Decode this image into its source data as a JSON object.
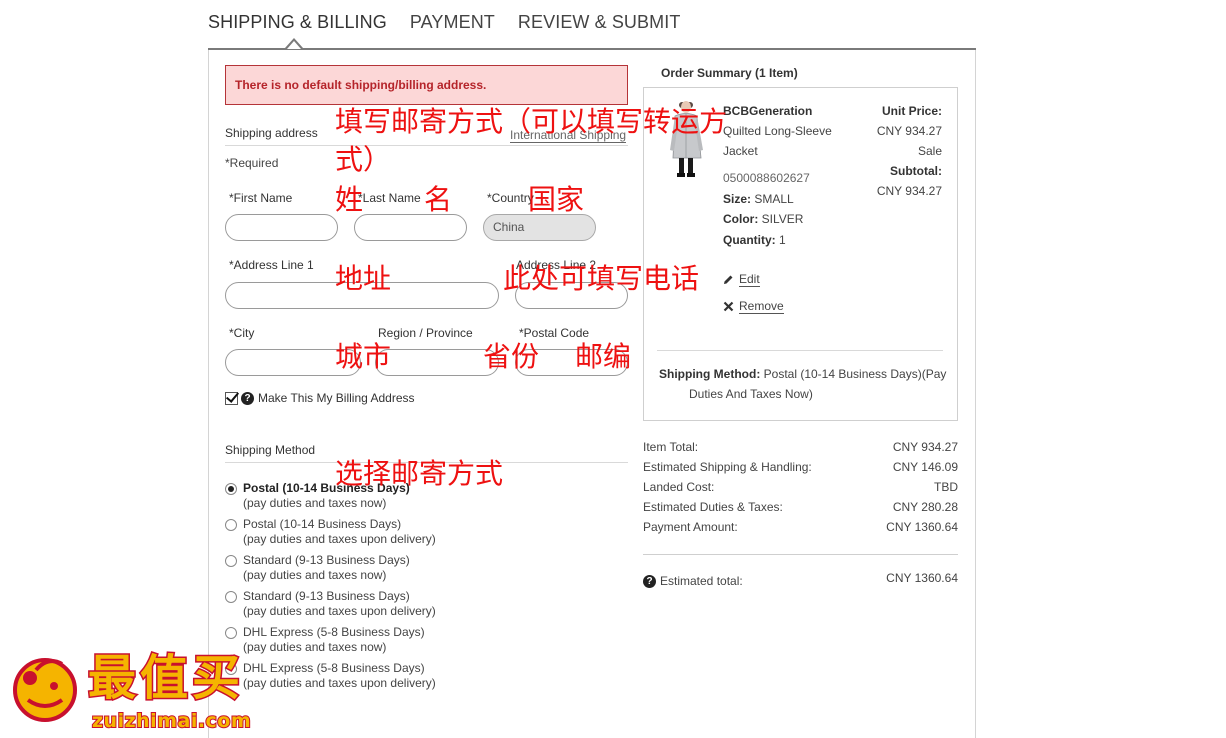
{
  "tabs": [
    "SHIPPING & BILLING",
    "PAYMENT",
    "REVIEW & SUBMIT"
  ],
  "alert": "There is no default shipping/billing address.",
  "address": {
    "section_label": "Shipping address",
    "intl_link": "International Shipping",
    "required": "*Required",
    "first_name_label": "*First Name",
    "last_name_label": "*Last Name",
    "country_label": "*Country",
    "country_value": "China",
    "address1_label": "*Address Line 1",
    "address2_label": "Address Line 2",
    "city_label": "*City",
    "region_label": "Region / Province",
    "postal_label": "*Postal Code",
    "billing_label": "Make This My Billing Address"
  },
  "shipping_method": {
    "label": "Shipping Method",
    "options": [
      {
        "title": "Postal (10-14 Business Days)",
        "sub": "(pay duties and taxes now)"
      },
      {
        "title": "Postal (10-14 Business Days)",
        "sub": "(pay duties and taxes upon delivery)"
      },
      {
        "title": "Standard (9-13 Business Days)",
        "sub": "(pay duties and taxes now)"
      },
      {
        "title": "Standard (9-13 Business Days)",
        "sub": "(pay duties and taxes upon delivery)"
      },
      {
        "title": "DHL Express (5-8 Business Days)",
        "sub": "(pay duties and taxes now)"
      },
      {
        "title": "DHL Express (5-8 Business Days)",
        "sub": "(pay duties and taxes upon delivery)"
      }
    ],
    "selected_index": 0
  },
  "summary": {
    "title": "Order Summary (1 Item)",
    "brand": "BCBGeneration",
    "name_line1": "Quilted Long-Sleeve",
    "name_line2": "Jacket",
    "sku": "0500088602627",
    "size_label": "Size:",
    "size_value": "SMALL",
    "color_label": "Color:",
    "color_value": "SILVER",
    "qty_label": "Quantity:",
    "qty_value": "1",
    "unit_price_label": "Unit Price:",
    "unit_price": "CNY 934.27",
    "sale": "Sale",
    "subtotal_label": "Subtotal:",
    "subtotal": "CNY 934.27",
    "edit": "Edit",
    "remove": "Remove",
    "ship_method_label": "Shipping Method:",
    "ship_method_value": "Postal (10-14 Business Days)(Pay",
    "ship_method_value2": "Duties And Taxes Now)"
  },
  "totals": [
    {
      "label": "Item Total:",
      "value": "CNY 934.27"
    },
    {
      "label": "Estimated Shipping & Handling:",
      "value": "CNY 146.09"
    },
    {
      "label": "Landed Cost:",
      "value": "TBD"
    },
    {
      "label": "Estimated Duties & Taxes:",
      "value": "CNY 280.28"
    },
    {
      "label": "Payment Amount:",
      "value": "CNY 1360.64"
    }
  ],
  "estimated_total_label": "Estimated total:",
  "estimated_total": "CNY 1360.64",
  "annotations": {
    "a1_line1": "填写邮寄方式（可以填写转运方",
    "a1_line2": "式）",
    "a2": "姓",
    "a3": "名",
    "a4": "国家",
    "a5": "地址",
    "a6": "此处可填写电话",
    "a7": "城市",
    "a8": "省份",
    "a9": "邮编",
    "a10": "选择邮寄方式"
  },
  "watermark": {
    "chars": "最值买",
    "domain": "zuizhimai.com"
  },
  "colors": {
    "alert_bg": "#fcd7d7",
    "alert_text": "#b5242a",
    "annotation": "#ee1111",
    "watermark_fill": "#f5b400",
    "watermark_stroke": "#c8102e"
  }
}
